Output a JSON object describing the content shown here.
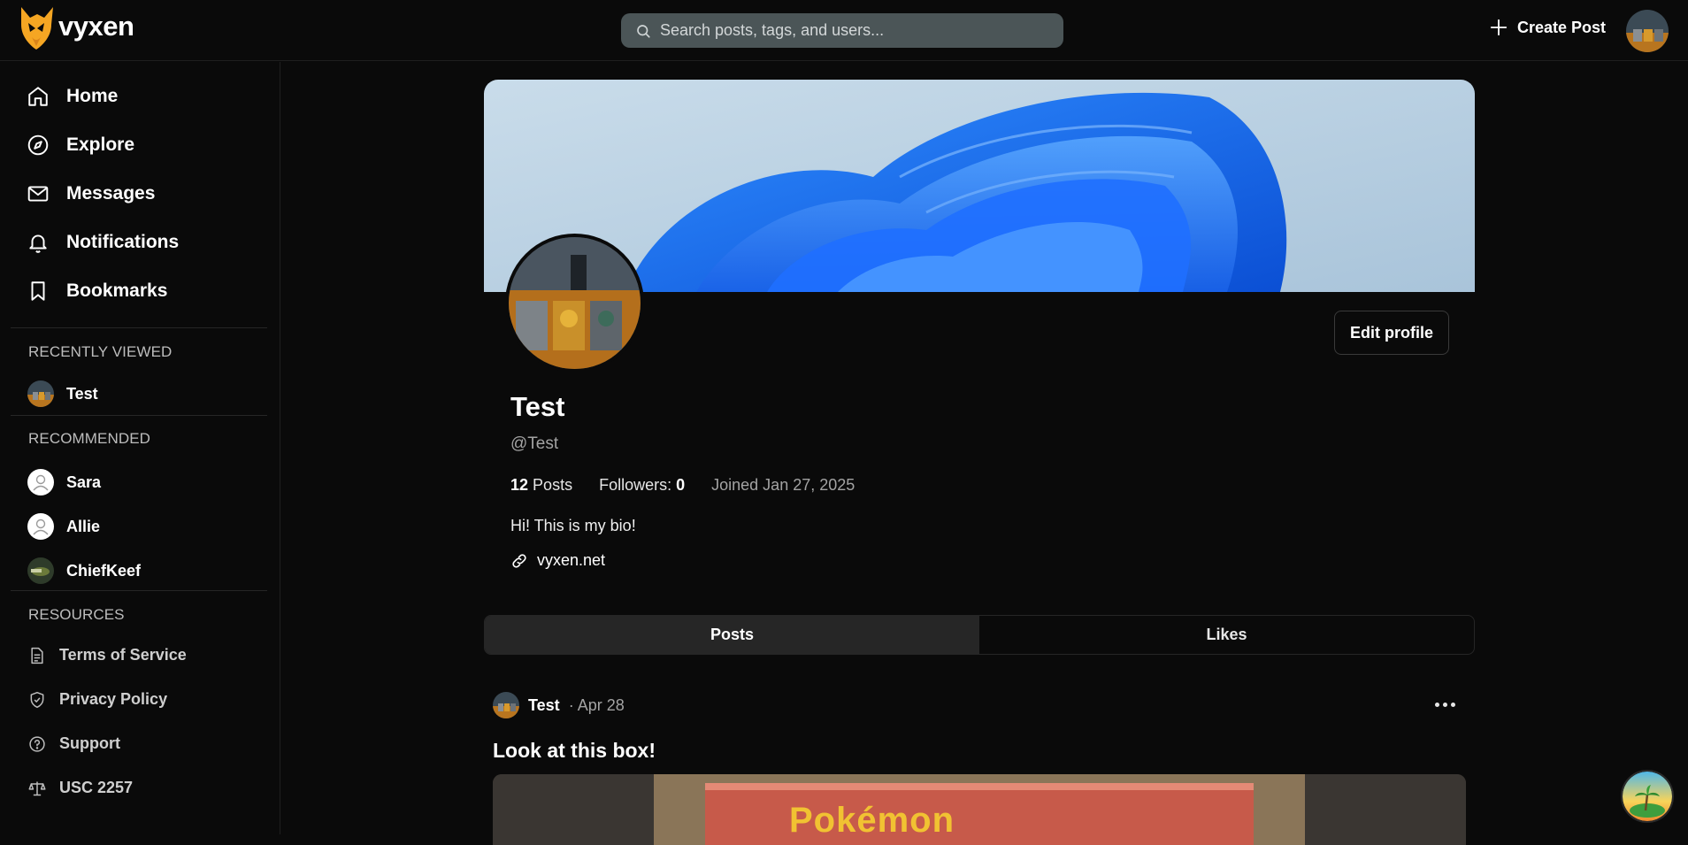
{
  "app": {
    "name": "vyxen"
  },
  "search": {
    "placeholder": "Search posts, tags, and users..."
  },
  "header": {
    "create_post_label": "Create Post"
  },
  "sidebar": {
    "nav": [
      {
        "label": "Home",
        "icon": "home-icon"
      },
      {
        "label": "Explore",
        "icon": "compass-icon"
      },
      {
        "label": "Messages",
        "icon": "mail-icon"
      },
      {
        "label": "Notifications",
        "icon": "bell-icon"
      },
      {
        "label": "Bookmarks",
        "icon": "bookmark-icon"
      }
    ],
    "recently_viewed": {
      "title": "RECENTLY VIEWED",
      "items": [
        {
          "name": "Test"
        }
      ]
    },
    "recommended": {
      "title": "RECOMMENDED",
      "items": [
        {
          "name": "Sara"
        },
        {
          "name": "Allie"
        },
        {
          "name": "ChiefKeef"
        }
      ]
    },
    "resources": {
      "title": "RESOURCES",
      "items": [
        {
          "label": "Terms of Service",
          "icon": "document-icon"
        },
        {
          "label": "Privacy Policy",
          "icon": "shield-icon"
        },
        {
          "label": "Support",
          "icon": "help-circle-icon"
        },
        {
          "label": "USC 2257",
          "icon": "scale-icon"
        }
      ]
    }
  },
  "profile": {
    "display_name": "Test",
    "handle": "@Test",
    "posts_count": "12",
    "posts_label": "Posts",
    "followers_label": "Followers:",
    "followers_count": "0",
    "joined": "Joined Jan 27, 2025",
    "bio": "Hi! This is my bio!",
    "link": "vyxen.net",
    "edit_label": "Edit profile"
  },
  "tabs": [
    {
      "label": "Posts",
      "active": true
    },
    {
      "label": "Likes",
      "active": false
    }
  ],
  "post": {
    "author": "Test",
    "date": "· Apr 28",
    "title": "Look at this box!",
    "image_text": "Pokémon"
  },
  "colors": {
    "accent_logo": "#f5a623",
    "background": "#0a0a0a",
    "search_bg": "#4b5557",
    "tab_active_bg": "#262626"
  }
}
